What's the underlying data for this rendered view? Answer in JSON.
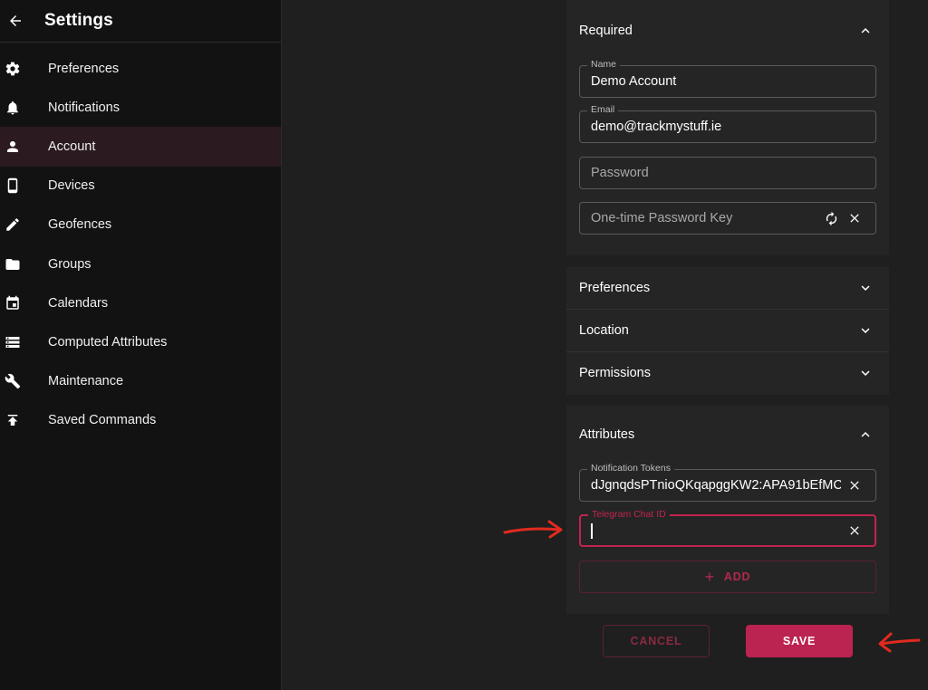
{
  "sidebar": {
    "title": "Settings",
    "items": [
      {
        "label": "Preferences",
        "icon": "gear-icon"
      },
      {
        "label": "Notifications",
        "icon": "bell-icon"
      },
      {
        "label": "Account",
        "icon": "person-icon",
        "active": true
      },
      {
        "label": "Devices",
        "icon": "phone-icon"
      },
      {
        "label": "Geofences",
        "icon": "pencil-icon"
      },
      {
        "label": "Groups",
        "icon": "folder-icon"
      },
      {
        "label": "Calendars",
        "icon": "calendar-icon"
      },
      {
        "label": "Computed Attributes",
        "icon": "storage-icon"
      },
      {
        "label": "Maintenance",
        "icon": "wrench-icon"
      },
      {
        "label": "Saved Commands",
        "icon": "upload-icon"
      }
    ]
  },
  "required": {
    "title": "Required",
    "name": {
      "label": "Name",
      "value": "Demo Account"
    },
    "email": {
      "label": "Email",
      "value": "demo@trackmystuff.ie"
    },
    "password": {
      "placeholder": "Password"
    },
    "otp": {
      "placeholder": "One-time Password Key"
    }
  },
  "sections": {
    "preferences": "Preferences",
    "location": "Location",
    "permissions": "Permissions"
  },
  "attributes": {
    "title": "Attributes",
    "tokens": {
      "label": "Notification Tokens",
      "value": "dJgnqdsPTnioQKqapggKW2:APA91bEfMC"
    },
    "telegram": {
      "label": "Telegram Chat ID",
      "value": ""
    },
    "add_label": "ADD"
  },
  "actions": {
    "cancel_label": "CANCEL",
    "save_label": "SAVE"
  },
  "colors": {
    "accent": "#bb2350",
    "annotation": "#e02a1f"
  }
}
